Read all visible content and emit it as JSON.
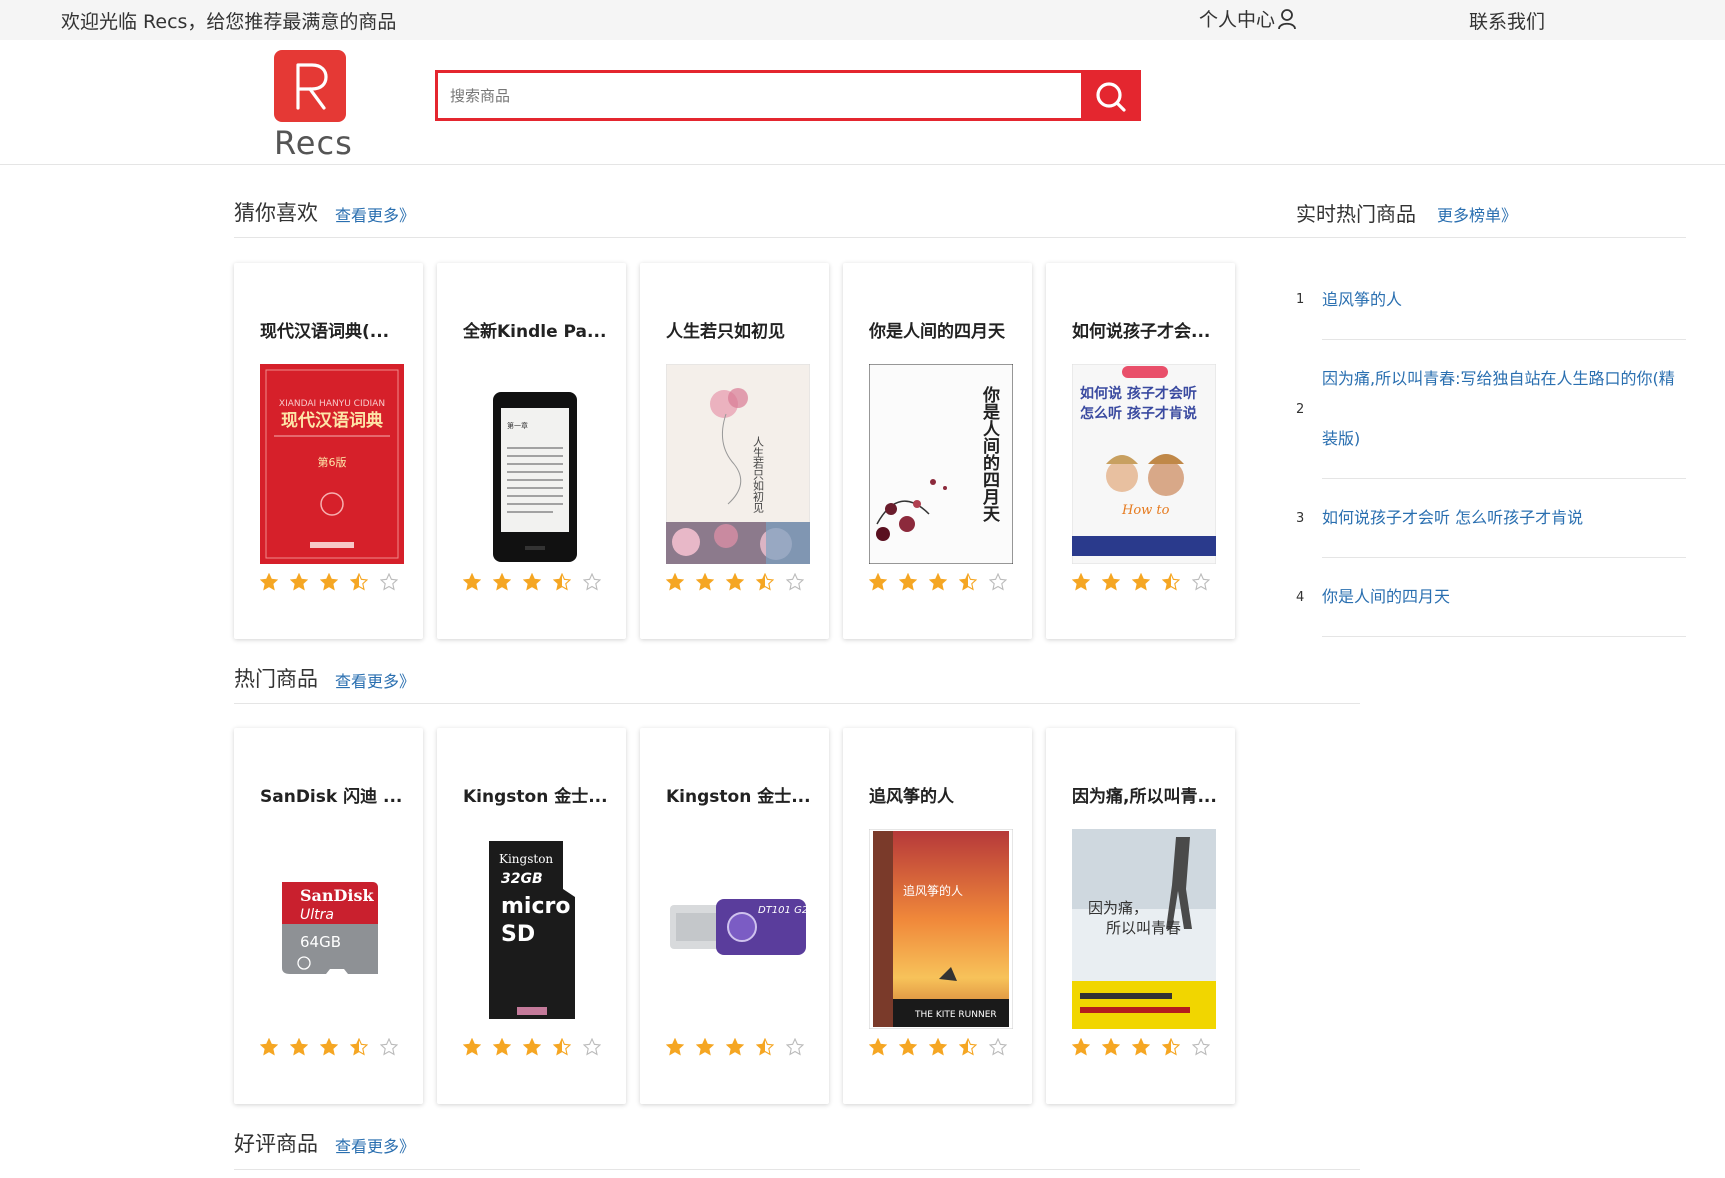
{
  "topbar": {
    "welcome": "欢迎光临 Recs，给您推荐最满意的商品",
    "user_center": "个人中心",
    "contact": "联系我们"
  },
  "header": {
    "logo_letter": "R",
    "logo_text": "Recs",
    "search_placeholder": "搜索商品",
    "brand_color": "#e4262f"
  },
  "sections": [
    {
      "title": "猜你喜欢",
      "more": "查看更多》",
      "products": [
        {
          "name": "现代汉语词典(...",
          "rating": 3.5
        },
        {
          "name": "全新Kindle Pa...",
          "rating": 3.5
        },
        {
          "name": "人生若只如初见",
          "rating": 3.5
        },
        {
          "name": "你是人间的四月天",
          "rating": 3.5
        },
        {
          "name": "如何说孩子才会...",
          "rating": 3.5
        }
      ]
    },
    {
      "title": "热门商品",
      "more": "查看更多》",
      "products": [
        {
          "name": "SanDisk 闪迪 ...",
          "rating": 3.5
        },
        {
          "name": "Kingston 金士...",
          "rating": 3.5
        },
        {
          "name": "Kingston 金士...",
          "rating": 3.5
        },
        {
          "name": "追风筝的人",
          "rating": 3.5
        },
        {
          "name": "因为痛,所以叫青...",
          "rating": 3.5
        }
      ]
    },
    {
      "title": "好评商品",
      "more": "查看更多》"
    }
  ],
  "hot_list": {
    "title": "实时热门商品",
    "more": "更多榜单》",
    "items": [
      {
        "rank": "1",
        "name": "追风筝的人"
      },
      {
        "rank": "2",
        "name": "因为痛,所以叫青春:写给独自站在人生路口的你(精装版)"
      },
      {
        "rank": "3",
        "name": "如何说孩子才会听 怎么听孩子才肯说"
      },
      {
        "rank": "4",
        "name": "你是人间的四月天"
      }
    ]
  },
  "image_text": {
    "dict_pinyin": "XIANDAI HANYU CIDIAN",
    "dict_title": "现代汉语词典",
    "dict_edition": "第6版",
    "kindle_chapter": "第一章",
    "book1_title": "人生若只如初见",
    "book2_title": "你是人间的四月天",
    "book3_line1": "如何说 孩子才会听",
    "book3_line2": "怎么听 孩子才肯说",
    "book3_howto": "How to",
    "sd_brand": "SanDisk",
    "sd_line": "Ultra",
    "sd_capacity": "64GB",
    "ks_brand": "Kingston",
    "ks_capacity": "32GB",
    "usb_model": "DT101 G2",
    "kite_title": "追风筝的人",
    "kite_en": "THE KITE RUNNER",
    "youth_title1": "因为痛，",
    "youth_title2": "所以叫青春"
  }
}
